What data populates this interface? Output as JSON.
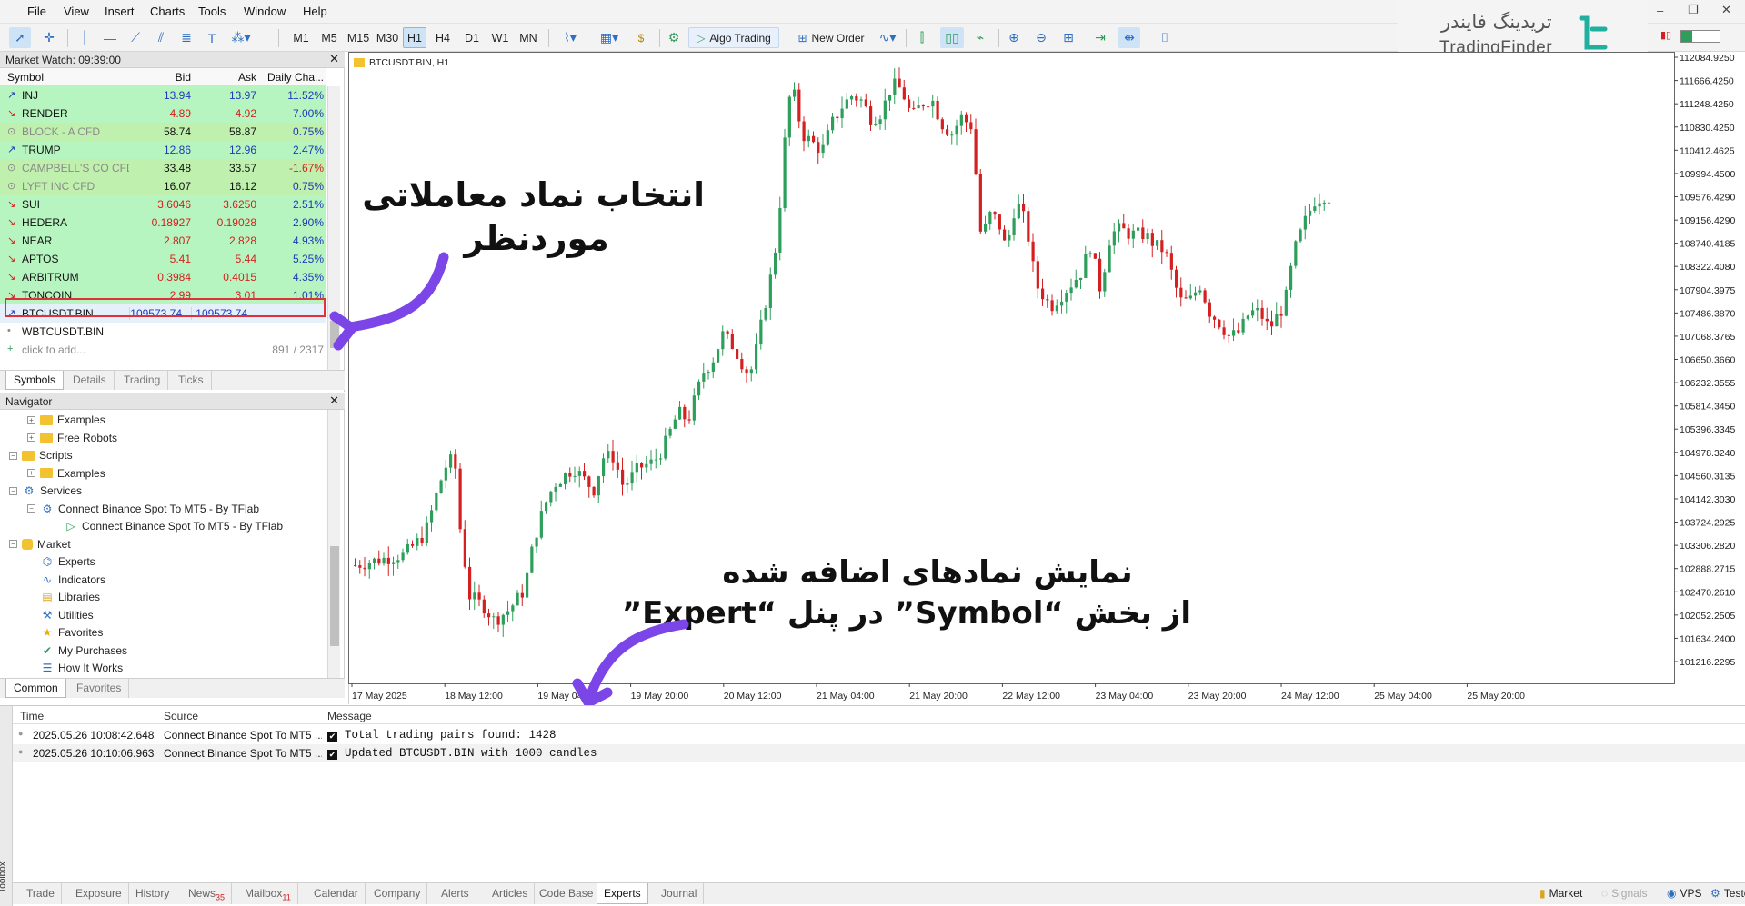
{
  "menu": [
    "File",
    "View",
    "Insert",
    "Charts",
    "Tools",
    "Window",
    "Help"
  ],
  "toolbar": {
    "timeframes": [
      "M1",
      "M5",
      "M15",
      "M30",
      "H1",
      "H4",
      "D1",
      "W1",
      "MN"
    ],
    "active_tf": "H1",
    "algo": "Algo Trading",
    "new_order": "New Order"
  },
  "logo": {
    "fa": "تریدینگ فایندر",
    "en": "TradingFinder"
  },
  "market_watch": {
    "title": "Market Watch: 09:39:00",
    "headers": [
      "Symbol",
      "Bid",
      "Ask",
      "Daily Cha..."
    ],
    "rows": [
      {
        "sym": "INJ",
        "bid": "13.94",
        "ask": "13.97",
        "chg": "11.52%",
        "bg": "green",
        "dir": "up",
        "bidc": "blue"
      },
      {
        "sym": "RENDER",
        "bid": "4.89",
        "ask": "4.92",
        "chg": "7.00%",
        "bg": "green",
        "dir": "down",
        "bidc": "red"
      },
      {
        "sym": "BLOCK - A CFD",
        "bid": "58.74",
        "ask": "58.87",
        "chg": "0.75%",
        "bg": "gold",
        "dir": "cfd",
        "bidc": "",
        "symc": "gray"
      },
      {
        "sym": "TRUMP",
        "bid": "12.86",
        "ask": "12.96",
        "chg": "2.47%",
        "bg": "green",
        "dir": "up",
        "bidc": "blue"
      },
      {
        "sym": "CAMPBELL'S CO CFD",
        "bid": "33.48",
        "ask": "33.57",
        "chg": "-1.67%",
        "bg": "gold",
        "dir": "cfd",
        "bidc": "",
        "symc": "gray",
        "chgc": "red"
      },
      {
        "sym": "LYFT INC CFD",
        "bid": "16.07",
        "ask": "16.12",
        "chg": "0.75%",
        "bg": "gold",
        "dir": "cfd",
        "bidc": "",
        "symc": "gray"
      },
      {
        "sym": "SUI",
        "bid": "3.6046",
        "ask": "3.6250",
        "chg": "2.51%",
        "bg": "green",
        "dir": "down",
        "bidc": "red"
      },
      {
        "sym": "HEDERA",
        "bid": "0.18927",
        "ask": "0.19028",
        "chg": "2.90%",
        "bg": "green",
        "dir": "down",
        "bidc": "red"
      },
      {
        "sym": "NEAR",
        "bid": "2.807",
        "ask": "2.828",
        "chg": "4.93%",
        "bg": "green",
        "dir": "down",
        "bidc": "red"
      },
      {
        "sym": "APTOS",
        "bid": "5.41",
        "ask": "5.44",
        "chg": "5.25%",
        "bg": "green",
        "dir": "down",
        "bidc": "red"
      },
      {
        "sym": "ARBITRUM",
        "bid": "0.3984",
        "ask": "0.4015",
        "chg": "4.35%",
        "bg": "green",
        "dir": "down",
        "bidc": "red"
      },
      {
        "sym": "TONCOIN",
        "bid": "2.99",
        "ask": "3.01",
        "chg": "1.01%",
        "bg": "green",
        "dir": "down",
        "bidc": "red"
      },
      {
        "sym": "BTCUSDT.BIN",
        "bid": "109573.74...",
        "ask": "109573.74...",
        "chg": "",
        "bg": "sel",
        "dir": "up",
        "bidc": "blue"
      },
      {
        "sym": "WBTCUSDT.BIN",
        "bid": "",
        "ask": "",
        "chg": "",
        "bg": "",
        "dir": "dot",
        "bidc": ""
      }
    ],
    "add": "click to add...",
    "count": "891 / 2317",
    "tabs": [
      "Symbols",
      "Details",
      "Trading",
      "Ticks"
    ]
  },
  "navigator": {
    "title": "Navigator",
    "items": [
      {
        "t": "Examples",
        "lvl": 2,
        "kind": "folder",
        "pm": "+"
      },
      {
        "t": "Free Robots",
        "lvl": 2,
        "kind": "folder",
        "pm": "+"
      },
      {
        "t": "Scripts",
        "lvl": 1,
        "kind": "folder",
        "pm": "-"
      },
      {
        "t": "Examples",
        "lvl": 2,
        "kind": "folder",
        "pm": "+"
      },
      {
        "t": "Services",
        "lvl": 1,
        "kind": "gear",
        "pm": "-"
      },
      {
        "t": "Connect Binance Spot To MT5 - By TFlab",
        "lvl": 2,
        "kind": "gear",
        "pm": "-"
      },
      {
        "t": "Connect Binance Spot To MT5 - By TFlab",
        "lvl": 3,
        "kind": "play",
        "pm": ""
      },
      {
        "t": "Market",
        "lvl": 1,
        "kind": "bag",
        "pm": "-"
      },
      {
        "t": "Experts",
        "lvl": 2,
        "kind": "expert",
        "pm": ""
      },
      {
        "t": "Indicators",
        "lvl": 2,
        "kind": "ind",
        "pm": ""
      },
      {
        "t": "Libraries",
        "lvl": 2,
        "kind": "lib",
        "pm": ""
      },
      {
        "t": "Utilities",
        "lvl": 2,
        "kind": "util",
        "pm": ""
      },
      {
        "t": "Favorites",
        "lvl": 2,
        "kind": "star",
        "pm": ""
      },
      {
        "t": "My Purchases",
        "lvl": 2,
        "kind": "check",
        "pm": ""
      },
      {
        "t": "How It Works",
        "lvl": 2,
        "kind": "list",
        "pm": ""
      }
    ],
    "tabs": [
      "Common",
      "Favorites"
    ]
  },
  "chart": {
    "title": "BTCUSDT.BIN, H1",
    "price_labels": [
      "112084.9250",
      "111666.4250",
      "111248.4250",
      "110830.4250",
      "110412.4625",
      "109994.4500",
      "109576.4290",
      "109156.4290",
      "108740.4185",
      "108322.4080",
      "107904.3975",
      "107486.3870",
      "107068.3765",
      "106650.3660",
      "106232.3555",
      "105814.3450",
      "105396.3345",
      "104978.3240",
      "104560.3135",
      "104142.3030",
      "103724.2925",
      "103306.2820",
      "102888.2715",
      "102470.2610",
      "102052.2505",
      "101634.2400",
      "101216.2295"
    ],
    "time_labels": [
      "17 May 2025",
      "18 May 12:00",
      "19 May 04:00",
      "19 May 20:00",
      "20 May 12:00",
      "21 May 04:00",
      "21 May 20:00",
      "22 May 12:00",
      "23 May 04:00",
      "23 May 20:00",
      "24 May 12:00",
      "25 May 04:00",
      "25 May 20:00"
    ],
    "up_color": "#2e9e5b",
    "down_color": "#d42020"
  },
  "annotations": {
    "a1_line1": "انتخاب نماد معاملاتی",
    "a1_line2": "موردنظر",
    "a2_line1": "نمایش نمادهای اضافه شده",
    "a2_line2": "از بخش “Symbol” در پنل “Expert”",
    "arrow_color": "#7b45e8"
  },
  "toolbox": {
    "headers": [
      "Time",
      "Source",
      "Message"
    ],
    "rows": [
      {
        "time": "2025.05.26 10:08:42.648",
        "source": "Connect Binance Spot To MT5 ...",
        "msg": "Total trading pairs found: 1428"
      },
      {
        "time": "2025.05.26 10:10:06.963",
        "source": "Connect Binance Spot To MT5 ...",
        "msg": "Updated BTCUSDT.BIN with 1000 candles"
      }
    ],
    "label": "Toolbox",
    "tabs": [
      {
        "t": "Trade"
      },
      {
        "t": "Exposure"
      },
      {
        "t": "History"
      },
      {
        "t": "News",
        "n": "35"
      },
      {
        "t": "Mailbox",
        "n": "11"
      },
      {
        "t": "Calendar"
      },
      {
        "t": "Company"
      },
      {
        "t": "Alerts"
      },
      {
        "t": "Articles"
      },
      {
        "t": "Code Base"
      },
      {
        "t": "Experts"
      },
      {
        "t": "Journal"
      }
    ],
    "active_tab": "Experts",
    "right": [
      "Market",
      "Signals",
      "VPS",
      "Tester"
    ]
  }
}
